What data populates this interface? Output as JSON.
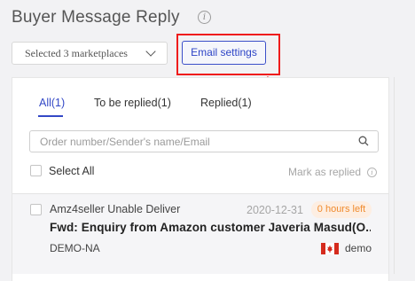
{
  "header": {
    "title": "Buyer Message Reply",
    "info_icon": "info-circle-icon"
  },
  "toolbar": {
    "marketplace_select_value": "Selected 3 marketplaces",
    "email_settings_label": "Email settings"
  },
  "tabs": [
    {
      "label": "All(1)",
      "active": true
    },
    {
      "label": "To be replied(1)",
      "active": false
    },
    {
      "label": "Replied(1)",
      "active": false
    }
  ],
  "search": {
    "placeholder": "Order number/Sender's name/Email",
    "value": ""
  },
  "list_controls": {
    "select_all_label": "Select All",
    "mark_as_replied_label": "Mark as replied"
  },
  "messages": [
    {
      "sender": "Amz4seller Unable Deliver",
      "date": "2020-12-31",
      "badge": "0 hours left",
      "subject": "Fwd: Enquiry from Amazon customer Javeria Masud(O...",
      "account": "DEMO-NA",
      "marketplace_flag": "canada-flag-icon",
      "store": "demo"
    }
  ],
  "colors": {
    "accent": "#3348c6",
    "annotation": "#ef1c1c",
    "badge_text": "#f08b2e",
    "badge_bg": "#fdeee2"
  }
}
